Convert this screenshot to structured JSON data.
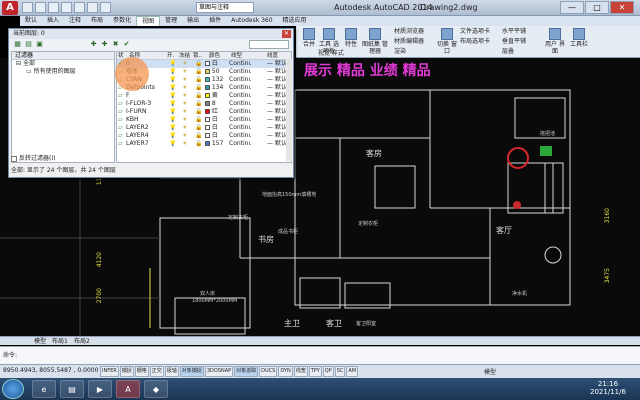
{
  "titlebar": {
    "app_letter": "A",
    "workspace": "草图与注释",
    "app_title": "Autodesk AutoCAD 2014",
    "doc_title": "Drawing2.dwg",
    "win_min": "—",
    "win_max": "□",
    "win_close": "✕"
  },
  "menu_tabs": [
    "默认",
    "插入",
    "注释",
    "布局",
    "参数化",
    "视图",
    "管理",
    "输出",
    "插件",
    "Autodesk 360",
    "精选应用"
  ],
  "menu_active_index": 5,
  "ribbon": {
    "tools": "工具\n选项板",
    "properties": "特性",
    "sheet_set": "图纸集\n管理器",
    "dashboard": "材质浏览器",
    "materials": "材质编辑器",
    "render": "渲染",
    "align_h": "水平平铺",
    "align_v": "垂直平铺",
    "cascade": "层叠",
    "switch_window": "切换\n窗口",
    "file_tabs": "文件选项卡",
    "user_iface": "用户\n界面",
    "toolbar": "工具栏",
    "layout_tab": "布局选项卡",
    "merge": "合并",
    "plot_style": "视觉 样式"
  },
  "drawing": {
    "labels": {
      "kitchen_title": "厨房",
      "bedroom": "客房",
      "bedroom_wardrobe": "定制衣柜",
      "study": "书房",
      "study_wardrobe": "定制衣柜",
      "study_desk": "成品书柜",
      "living": "客厅",
      "bath_main": "主卫",
      "bath_guest": "客卫",
      "master_wardrobe": "客卫阳室",
      "water_purifier": "净水机",
      "floor_heat": "地面抬高150mm填槽地",
      "bed_label": "双人床",
      "bed_size": "1800MM*2000MM",
      "decor_wall": "拖把池",
      "magenta_text": "展示 精品 业绩 精品"
    },
    "dims": [
      "2700",
      "4120",
      "11340",
      "3160",
      "3475"
    ]
  },
  "layer_panel": {
    "title": "当前图层: 0",
    "close": "✕",
    "search_placeholder": "搜索图层",
    "filter_header": "过滤器",
    "filter_nodes": [
      "全部",
      "所有使用的图层"
    ],
    "columns": [
      "状",
      "名称",
      "开.",
      "冻结",
      "锁..",
      "颜色",
      "线型",
      "线宽"
    ],
    "rows": [
      {
        "status": "✔",
        "name": "0",
        "color_name": "白",
        "color": "#ffffff",
        "linetype": "Continu...",
        "lineweight": "— 默认",
        "selected": true
      },
      {
        "status": "▱",
        "name": "墙体",
        "color_name": "50",
        "color": "#e2d85a",
        "linetype": "Continu...",
        "lineweight": "— 默认",
        "selected": false
      },
      {
        "status": "▱",
        "name": "CYAN",
        "color_name": "132",
        "color": "#3cc2b6",
        "linetype": "Continu...",
        "lineweight": "— 默认",
        "selected": false
      },
      {
        "status": "▱",
        "name": "Defpoints",
        "color_name": "134",
        "color": "#2aa1b0",
        "linetype": "Continu...",
        "lineweight": "— 默认",
        "selected": false
      },
      {
        "status": "▱",
        "name": "F",
        "color_name": "黄",
        "color": "#ffff00",
        "linetype": "Continu...",
        "lineweight": "— 默认",
        "selected": false
      },
      {
        "status": "▱",
        "name": "I-FLOR-3",
        "color_name": "8",
        "color": "#808080",
        "linetype": "Continu...",
        "lineweight": "— 默认",
        "selected": false
      },
      {
        "status": "▱",
        "name": "I-FURN",
        "color_name": "红",
        "color": "#ff0000",
        "linetype": "Continu...",
        "lineweight": "— 默认",
        "selected": false
      },
      {
        "status": "▱",
        "name": "KBH",
        "color_name": "白",
        "color": "#ffffff",
        "linetype": "Continu...",
        "lineweight": "— 默认",
        "selected": false
      },
      {
        "status": "▱",
        "name": "LAYER2",
        "color_name": "白",
        "color": "#ffffff",
        "linetype": "Continu...",
        "lineweight": "— 默认",
        "selected": false
      },
      {
        "status": "▱",
        "name": "LAYER4",
        "color_name": "白",
        "color": "#ffffff",
        "linetype": "Continu...",
        "lineweight": "— 默认",
        "selected": false
      },
      {
        "status": "▱",
        "name": "LAYER7",
        "color_name": "157",
        "color": "#4a78c8",
        "linetype": "Continu...",
        "lineweight": "— 默认",
        "selected": false
      }
    ],
    "invert_filter": "反转过滤器(I)",
    "summary": "全部: 显示了 24 个图层，共 24 个图层"
  },
  "layout_tabs": [
    "模型",
    "布局1",
    "布局2"
  ],
  "command": {
    "prompt": "命令:"
  },
  "statusbar": {
    "coords": "8950.4943, 8055.5487 , 0.0000",
    "toggles": [
      "INFER",
      "捕捉",
      "栅格",
      "正交",
      "极轴",
      "对象捕捉",
      "3DOSNAP",
      "对象追踪",
      "DUCS",
      "DYN",
      "线宽",
      "TPY",
      "QP",
      "SC",
      "AM"
    ],
    "toggles_on": [
      5,
      7
    ],
    "model": "模型"
  },
  "taskbar": {
    "time": "21:16",
    "date": "2021/11/6",
    "apps": [
      "IE",
      "文件夹",
      "媒体",
      "AutoCAD",
      "工具"
    ]
  }
}
